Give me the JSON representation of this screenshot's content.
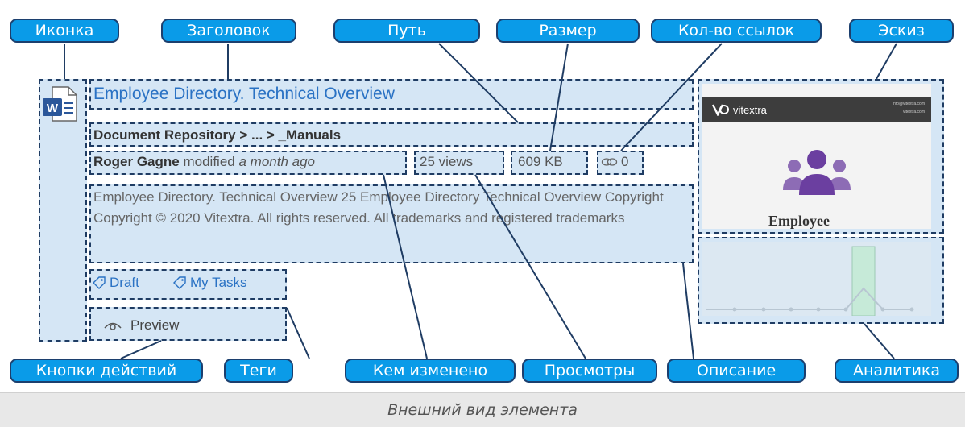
{
  "callouts": {
    "icon": "Иконка",
    "title": "Заголовок",
    "path": "Путь",
    "size": "Размер",
    "links_count": "Кол-во ссылок",
    "thumbnail": "Эскиз",
    "actions": "Кнопки действий",
    "tags": "Теги",
    "modified_by": "Кем изменено",
    "views": "Просмотры",
    "description": "Описание",
    "analytics": "Аналитика"
  },
  "item": {
    "title": "Employee Directory. Technical Overview",
    "path": "Document Repository > ... > _Manuals",
    "author": "Roger Gagne",
    "modified_word": "modified",
    "modified_when": "a month ago",
    "views": "25 views",
    "size": "609 KB",
    "links": "0",
    "description": "Employee Directory. Technical Overview 25 Employee Directory Technical Overview Copyright Copyright © 2020 Vitextra. All rights reserved. All trademarks and registered trademarks",
    "tags": [
      "Draft",
      "My Tasks"
    ],
    "action_label": "Preview",
    "file_icon": "word-document-icon"
  },
  "thumbnail": {
    "brand": "vitextra",
    "contact_1": "info@vitextra.com",
    "contact_2": "vitextra.com",
    "word": "Employee"
  },
  "caption": "Внешний вид элемента",
  "colors": {
    "callout_bg": "#0a9be8",
    "callout_border": "#1c3f6e",
    "dash_border": "#1f3c63",
    "region_bg": "#d5e6f5",
    "title_link": "#2a72c4",
    "people_icon": "#6b3fa0",
    "analytics_bar": "#c6ead8"
  }
}
